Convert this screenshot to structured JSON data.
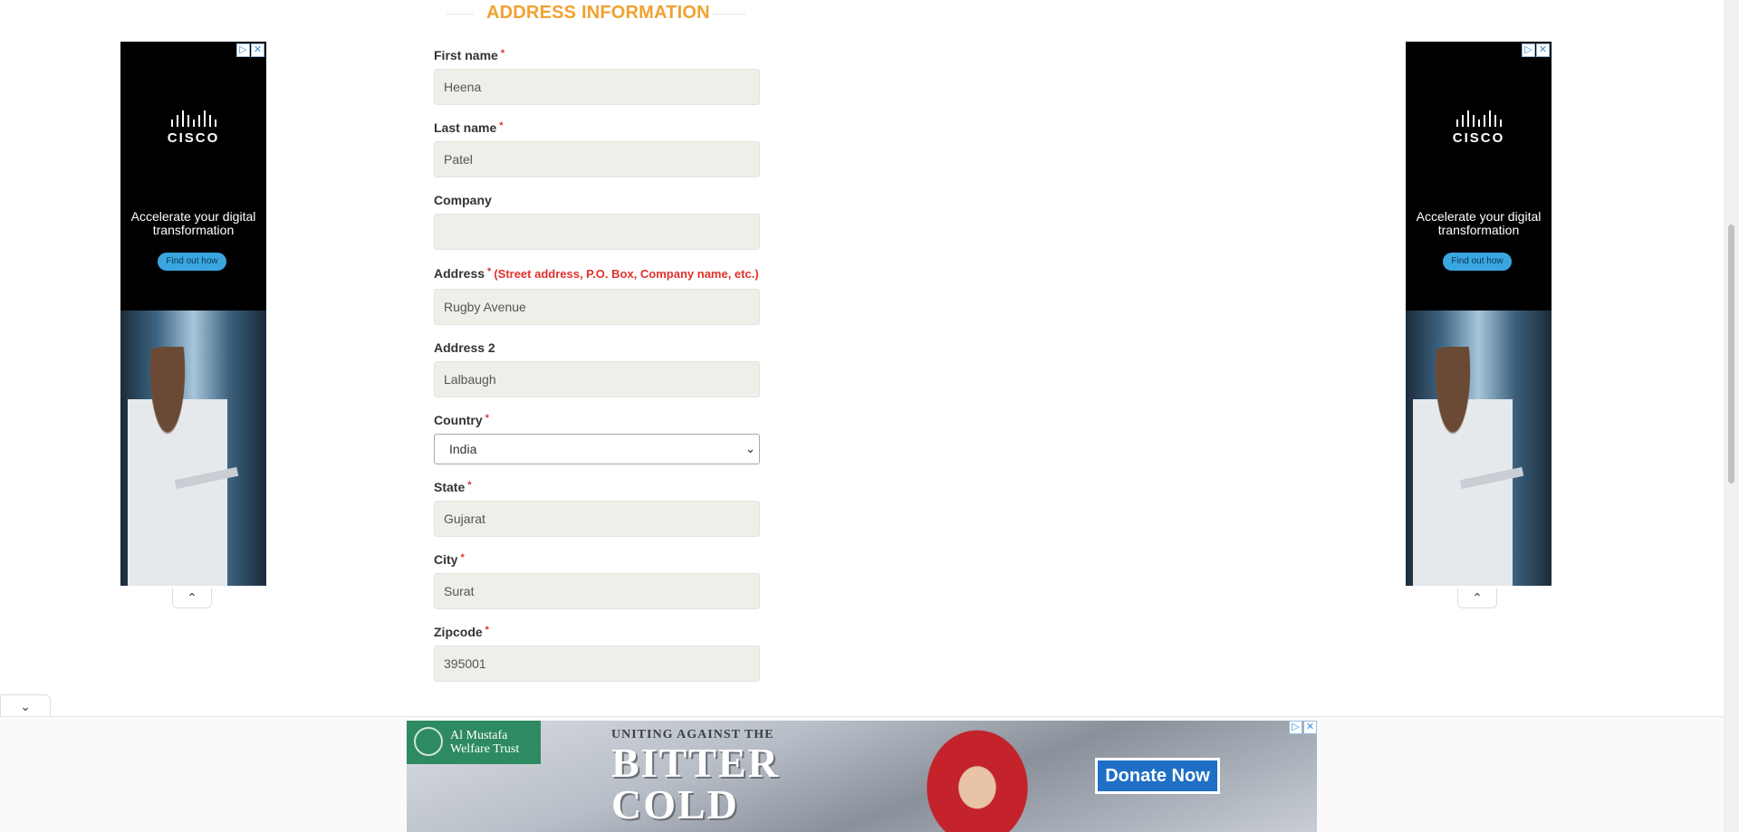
{
  "section": {
    "title": "ADDRESS INFORMATION"
  },
  "required_mark": "*",
  "form": {
    "first_name": {
      "label": "First name",
      "value": "Heena"
    },
    "last_name": {
      "label": "Last name",
      "value": "Patel"
    },
    "company": {
      "label": "Company",
      "value": ""
    },
    "address": {
      "label": "Address",
      "hint": "(Street address, P.O. Box, Company name, etc.)",
      "value": "Rugby Avenue"
    },
    "address2": {
      "label": "Address 2",
      "value": "Lalbaugh"
    },
    "country": {
      "label": "Country",
      "selected": "India"
    },
    "state": {
      "label": "State",
      "value": "Gujarat"
    },
    "city": {
      "label": "City",
      "value": "Surat"
    },
    "zipcode": {
      "label": "Zipcode",
      "value": "395001"
    }
  },
  "side_ads": {
    "brand": "CISCO",
    "headline": "Accelerate your digital transformation",
    "cta": "Find out how"
  },
  "bottom_ad": {
    "org_name": "Al Mustafa Welfare Trust",
    "tagline": "UNITING AGAINST THE",
    "headline_1": "BITTER",
    "headline_2": "COLD",
    "cta": "Donate Now"
  },
  "icons": {
    "adchoices": "ad-choices-icon",
    "close": "close-icon",
    "chevron_up": "chevron-up-icon",
    "chevron_down": "chevron-down-icon"
  },
  "colors": {
    "section_title": "#f0a231",
    "hint": "#e0312b",
    "input_bg": "#efeee8",
    "donate_button": "#1f6fc6",
    "org_green": "#2e8a61"
  }
}
